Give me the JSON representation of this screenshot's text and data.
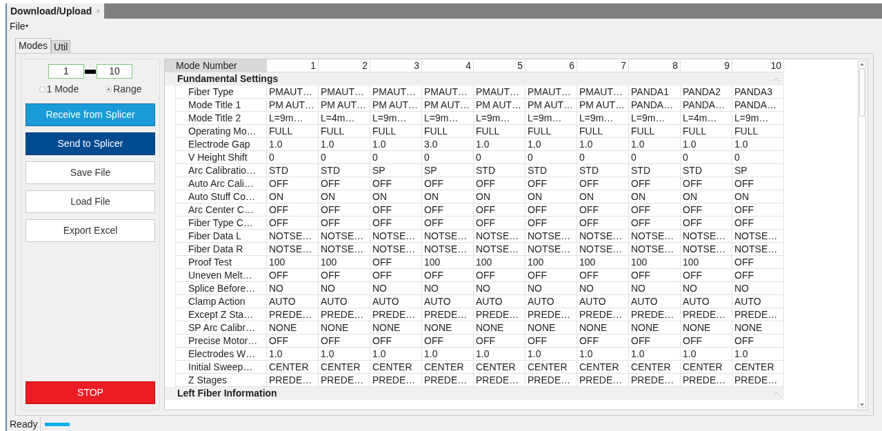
{
  "window": {
    "tab_title": "Download/Upload",
    "close": "×"
  },
  "menu": [
    {
      "label": "File",
      "caret": "▾"
    }
  ],
  "tabs": [
    {
      "label": "Modes",
      "selected": true
    },
    {
      "label": "Util",
      "selected": false
    }
  ],
  "range": {
    "from": "1",
    "to": "10"
  },
  "mode_options": [
    {
      "label": "1 Mode",
      "selected": false
    },
    {
      "label": "Range",
      "selected": true
    }
  ],
  "buttons": [
    {
      "label": "Receive from Splicer",
      "kind": "focused"
    },
    {
      "label": "Send to Splicer",
      "kind": "primary"
    },
    {
      "label": "Save File",
      "kind": "plain"
    },
    {
      "label": "Load File",
      "kind": "plain"
    },
    {
      "label": "Export Excel",
      "kind": "plain"
    }
  ],
  "stop_button": "STOP",
  "grid": {
    "header_label": "Mode Number",
    "columns": [
      "1",
      "2",
      "3",
      "4",
      "5",
      "6",
      "7",
      "8",
      "9",
      "10"
    ],
    "sections": [
      {
        "title": "Fundamental Settings",
        "expanded": true,
        "rows": [
          {
            "label": "Fiber Type",
            "values": [
              "PMAUT…",
              "PMAUT…",
              "PMAUT…",
              "PMAUT…",
              "PMAUT…",
              "PMAUT…",
              "PMAUT…",
              "PANDA1",
              "PANDA2",
              "PANDA3"
            ]
          },
          {
            "label": "Mode Title 1",
            "values": [
              "PM AUT…",
              "PM AUT…",
              "PM AUT…",
              "PM AUT…",
              "PM AUT…",
              "PM AUT…",
              "PM AUT…",
              "PANDA…",
              "PANDA…",
              "PANDA…"
            ]
          },
          {
            "label": "Mode Title 2",
            "values": [
              "L=9m…",
              "L=4m…",
              "L=9m…",
              "L=9m…",
              "L=9m…",
              "L=9m…",
              "L=9m…",
              "L=9m…",
              "L=4m…",
              "L=9m…"
            ]
          },
          {
            "label": "Operating Mo…",
            "values": [
              "FULL",
              "FULL",
              "FULL",
              "FULL",
              "FULL",
              "FULL",
              "FULL",
              "FULL",
              "FULL",
              "FULL"
            ]
          },
          {
            "label": "Electrode Gap",
            "values": [
              "1.0",
              "1.0",
              "1.0",
              "3.0",
              "1.0",
              "1.0",
              "1.0",
              "1.0",
              "1.0",
              "1.0"
            ]
          },
          {
            "label": "V Height Shift",
            "values": [
              "0",
              "0",
              "0",
              "0",
              "0",
              "0",
              "0",
              "0",
              "0",
              "0"
            ]
          },
          {
            "label": "Arc Calibratio…",
            "values": [
              "STD",
              "STD",
              "SP",
              "SP",
              "STD",
              "STD",
              "STD",
              "STD",
              "STD",
              "SP"
            ]
          },
          {
            "label": "Auto Arc Cali…",
            "values": [
              "OFF",
              "OFF",
              "OFF",
              "OFF",
              "OFF",
              "OFF",
              "OFF",
              "OFF",
              "OFF",
              "OFF"
            ]
          },
          {
            "label": "Auto Stuff Co…",
            "values": [
              "ON",
              "ON",
              "ON",
              "ON",
              "ON",
              "ON",
              "ON",
              "ON",
              "ON",
              "ON"
            ]
          },
          {
            "label": "Arc Center C…",
            "values": [
              "OFF",
              "OFF",
              "OFF",
              "OFF",
              "OFF",
              "OFF",
              "OFF",
              "OFF",
              "OFF",
              "OFF"
            ]
          },
          {
            "label": "Fiber Type C…",
            "values": [
              "OFF",
              "OFF",
              "OFF",
              "OFF",
              "OFF",
              "OFF",
              "OFF",
              "OFF",
              "OFF",
              "OFF"
            ]
          },
          {
            "label": "Fiber Data L",
            "values": [
              "NOTSE…",
              "NOTSE…",
              "NOTSE…",
              "NOTSE…",
              "NOTSE…",
              "NOTSE…",
              "NOTSE…",
              "NOTSE…",
              "NOTSE…",
              "NOTSE…"
            ]
          },
          {
            "label": "Fiber Data R",
            "values": [
              "NOTSE…",
              "NOTSE…",
              "NOTSE…",
              "NOTSE…",
              "NOTSE…",
              "NOTSE…",
              "NOTSE…",
              "NOTSE…",
              "NOTSE…",
              "NOTSE…"
            ]
          },
          {
            "label": "Proof Test",
            "values": [
              "100",
              "100",
              "OFF",
              "100",
              "100",
              "100",
              "100",
              "100",
              "100",
              "OFF"
            ]
          },
          {
            "label": "Uneven Melt…",
            "values": [
              "OFF",
              "OFF",
              "OFF",
              "OFF",
              "OFF",
              "OFF",
              "OFF",
              "OFF",
              "OFF",
              "OFF"
            ]
          },
          {
            "label": "Splice Before…",
            "values": [
              "NO",
              "NO",
              "NO",
              "NO",
              "NO",
              "NO",
              "NO",
              "NO",
              "NO",
              "NO"
            ]
          },
          {
            "label": "Clamp Action",
            "values": [
              "AUTO",
              "AUTO",
              "AUTO",
              "AUTO",
              "AUTO",
              "AUTO",
              "AUTO",
              "AUTO",
              "AUTO",
              "AUTO"
            ]
          },
          {
            "label": "Except Z Sta…",
            "values": [
              "PREDE…",
              "PREDE…",
              "PREDE…",
              "PREDE…",
              "PREDE…",
              "PREDE…",
              "PREDE…",
              "PREDE…",
              "PREDE…",
              "PREDE…"
            ]
          },
          {
            "label": "SP Arc Calibr…",
            "values": [
              "NONE",
              "NONE",
              "NONE",
              "NONE",
              "NONE",
              "NONE",
              "NONE",
              "NONE",
              "NONE",
              "NONE"
            ]
          },
          {
            "label": "Precise Motor…",
            "values": [
              "OFF",
              "OFF",
              "OFF",
              "OFF",
              "OFF",
              "OFF",
              "OFF",
              "OFF",
              "OFF",
              "OFF"
            ]
          },
          {
            "label": "Electrodes W…",
            "values": [
              "1.0",
              "1.0",
              "1.0",
              "1.0",
              "1.0",
              "1.0",
              "1.0",
              "1.0",
              "1.0",
              "1.0"
            ]
          },
          {
            "label": "Initial Sweep…",
            "values": [
              "CENTER",
              "CENTER",
              "CENTER",
              "CENTER",
              "CENTER",
              "CENTER",
              "CENTER",
              "CENTER",
              "CENTER",
              "CENTER"
            ]
          },
          {
            "label": "Z Stages",
            "values": [
              "PREDE…",
              "PREDE…",
              "PREDE…",
              "PREDE…",
              "PREDE…",
              "PREDE…",
              "PREDE…",
              "PREDE…",
              "PREDE…",
              "PREDE…"
            ]
          }
        ]
      },
      {
        "title": "Left Fiber Information",
        "expanded": true
      }
    ]
  },
  "status_bar": {
    "text": "Ready"
  }
}
